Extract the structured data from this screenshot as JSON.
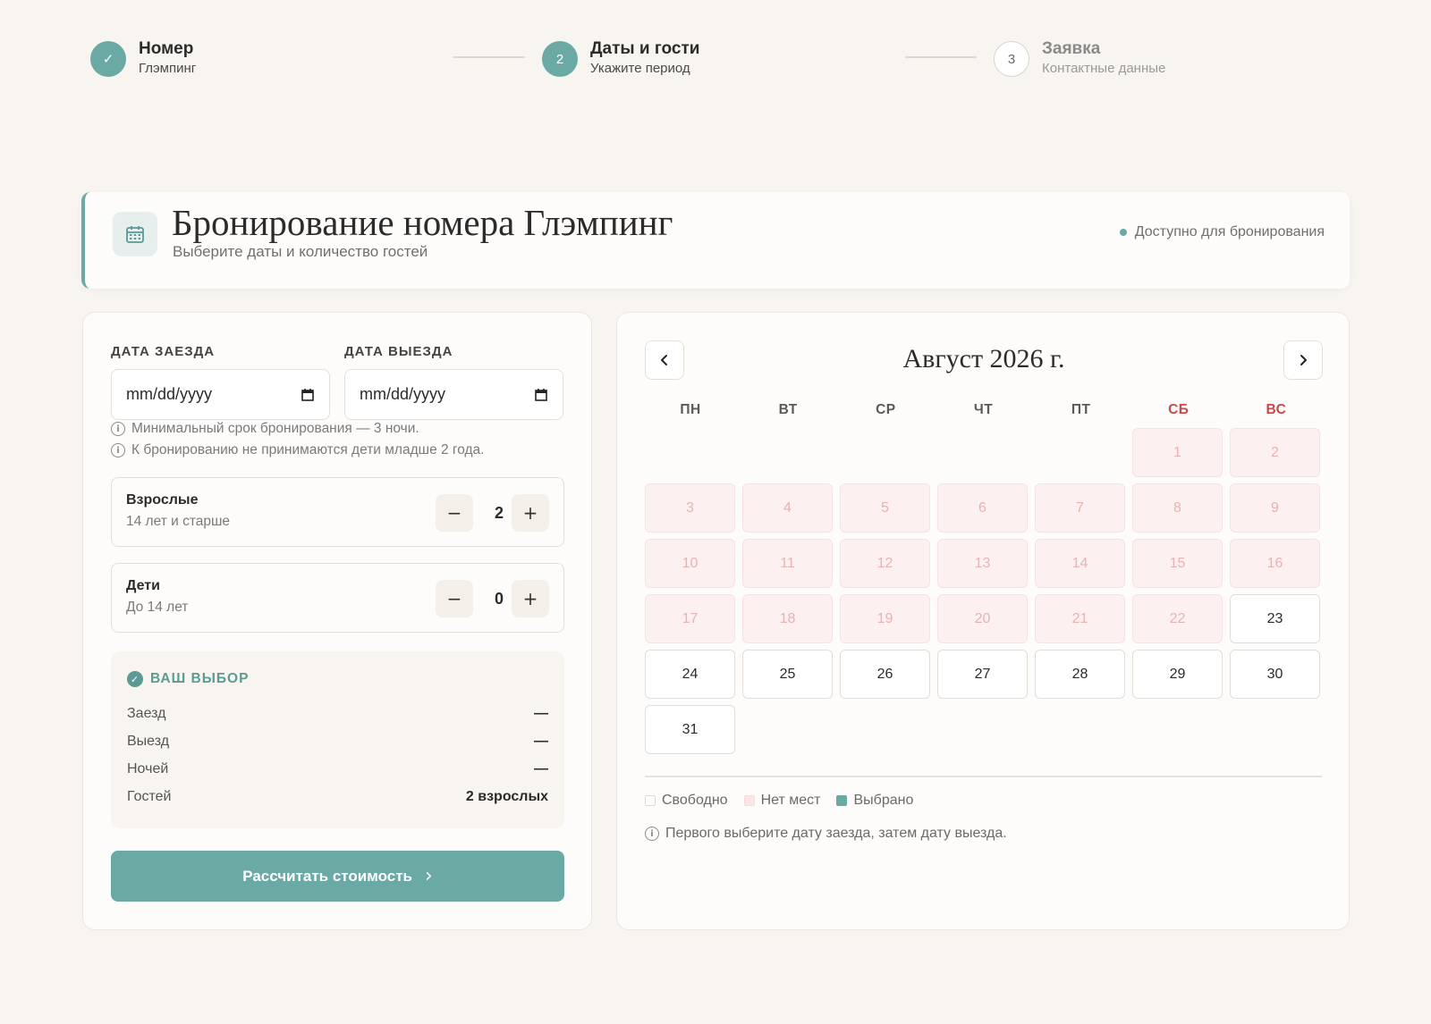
{
  "stepper": {
    "steps": [
      {
        "number": "✓",
        "title": "Номер",
        "subtitle": "Глэмпинг",
        "state": "done"
      },
      {
        "number": "2",
        "title": "Даты и гости",
        "subtitle": "Укажите период",
        "state": "active"
      },
      {
        "number": "3",
        "title": "Заявка",
        "subtitle": "Контактные данные",
        "state": "pending"
      }
    ]
  },
  "header": {
    "title": "Бронирование номера Глэмпинг",
    "subtitle": "Выберите даты и количество гостей",
    "status": "Доступно для бронирования"
  },
  "form": {
    "checkin_label": "ДАТА ЗАЕЗДА",
    "checkout_label": "ДАТА ВЫЕЗДА",
    "checkin_placeholder": "mm/dd/yyyy",
    "checkout_placeholder": "mm/dd/yyyy",
    "notes": [
      "Минимальный срок бронирования — 3 ночи.",
      "К бронированию не принимаются дети младше 2 года."
    ],
    "adults": {
      "title": "Взрослые",
      "subtitle": "14 лет и старше",
      "value": "2",
      "minus": "−",
      "plus": "+"
    },
    "children": {
      "title": "Дети",
      "subtitle": "До 14 лет",
      "value": "0",
      "minus": "−",
      "plus": "+"
    },
    "summary": {
      "title": "ВАШ ВЫБОР",
      "rows": [
        {
          "label": "Заезд",
          "value": "—"
        },
        {
          "label": "Выезд",
          "value": "—"
        },
        {
          "label": "Ночей",
          "value": "—"
        },
        {
          "label": "Гостей",
          "value": "2 взрослых"
        }
      ]
    },
    "submit_label": "Рассчитать стоимость"
  },
  "calendar": {
    "title": "Август 2026 г.",
    "weekdays": [
      "ПН",
      "ВТ",
      "СР",
      "ЧТ",
      "ПТ",
      "СБ",
      "ВС"
    ],
    "leading_blanks": 5,
    "days_in_month": 31,
    "first_free_day": 23,
    "legend": {
      "free": "Свободно",
      "busy": "Нет мест",
      "selected": "Выбрано"
    },
    "hint": "Первого выберите дату заезда, затем дату выезда.",
    "colors": {
      "busy_bg": "#fdf0f0",
      "free_bg": "#ffffff",
      "selected": "#6aa9a4",
      "weekend_label": "#c9474d"
    }
  },
  "colors": {
    "accent": "#6aa9a4",
    "background": "#f8f4ef"
  }
}
